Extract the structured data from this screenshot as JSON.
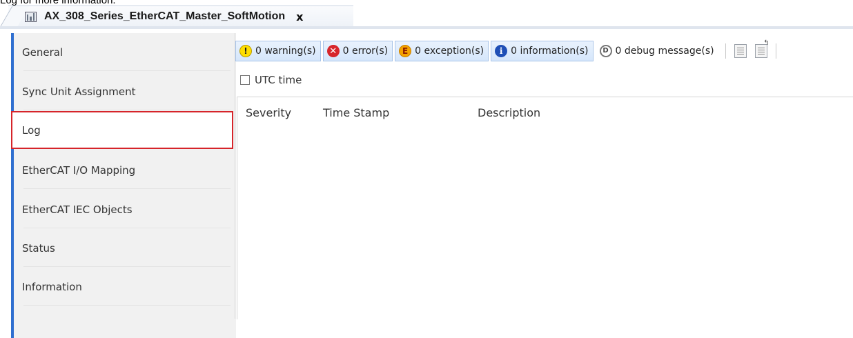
{
  "caption": "Log for more information.",
  "document_tab": {
    "title": "AX_308_Series_EtherCAT_Master_SoftMotion",
    "icon": "device-icon",
    "close_label": "x"
  },
  "sidebar": {
    "items": [
      {
        "label": "General",
        "active": false
      },
      {
        "label": "Sync Unit Assignment",
        "active": false
      },
      {
        "label": "Log",
        "active": true
      },
      {
        "label": "EtherCAT I/O Mapping",
        "active": false
      },
      {
        "label": "EtherCAT IEC Objects",
        "active": false
      },
      {
        "label": "Status",
        "active": false
      },
      {
        "label": "Information",
        "active": false
      }
    ]
  },
  "toolbar": {
    "warnings": "0 warning(s)",
    "errors": "0 error(s)",
    "exceptions": "0 exception(s)",
    "information": "0 information(s)",
    "debug": "0 debug message(s)",
    "icons": {
      "warnings": "!",
      "errors": "✕",
      "exceptions": "E",
      "information": "i",
      "debug": "D"
    }
  },
  "utc": {
    "label": "UTC time",
    "checked": false
  },
  "log_table": {
    "columns": [
      "Severity",
      "Time Stamp",
      "Description"
    ],
    "rows": []
  },
  "colors": {
    "active_border": "#d6242a",
    "sidebar_accent": "#2f6fd0",
    "toolbar_button_bg": "#dce9fb"
  }
}
